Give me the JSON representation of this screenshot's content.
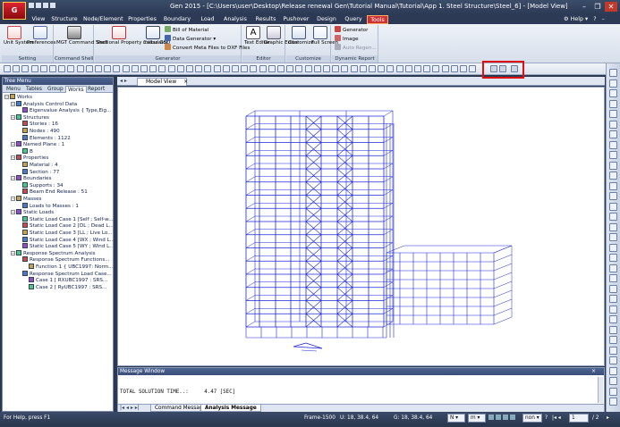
{
  "app": {
    "title": "Gen 2015 - [C:\\Users\\user\\Desktop\\Release renewal Gen\\Tutorial Manual\\Tutorial\\App 1. Steel Structure\\Steel_6] - [Model View]",
    "logo": "G"
  },
  "ribbon_tabs": [
    "View",
    "Structure",
    "Node/Element",
    "Properties",
    "Boundary",
    "Load",
    "Analysis",
    "Results",
    "Pushover",
    "Design",
    "Query",
    "Tools"
  ],
  "active_ribbon_tab": "Tools",
  "help": {
    "label": "Help"
  },
  "ribbon": {
    "groups": [
      {
        "label": "Setting",
        "buttons": [
          "Unit System",
          "Preferences"
        ]
      },
      {
        "label": "Command Shell",
        "buttons": [
          "MGT Command Shell"
        ]
      },
      {
        "label": "Generator",
        "buttons": [
          "Sectional Property Calculator",
          "midas GSD"
        ],
        "small": [
          "Bill of Material",
          "Data Generator",
          "Convert Meta Files to DXF Files"
        ]
      },
      {
        "label": "Editor",
        "buttons": [
          "Text Editor",
          "Graphic Editor"
        ]
      },
      {
        "label": "Customize",
        "buttons": [
          "Customize",
          "Full Screen"
        ]
      },
      {
        "label": "Dynamic Report",
        "small": [
          "Generator",
          "Image",
          "Auto Regen..."
        ]
      }
    ]
  },
  "tree_menu": {
    "title": "Tree Menu",
    "tabs": [
      "Menu",
      "Tables",
      "Group",
      "Works",
      "Report"
    ],
    "active_tab": "Works",
    "nodes": [
      {
        "label": "Works",
        "level": 0
      },
      {
        "label": "Analysis Control Data",
        "level": 1
      },
      {
        "label": "Eigenvalue Analysis { Type,Eig...",
        "level": 2
      },
      {
        "label": "Structures",
        "level": 1
      },
      {
        "label": "Stories : 16",
        "level": 2
      },
      {
        "label": "Nodes : 490",
        "level": 2
      },
      {
        "label": "Elements : 1122",
        "level": 2
      },
      {
        "label": "Named Plane : 1",
        "level": 1
      },
      {
        "label": "B",
        "level": 2
      },
      {
        "label": "Properties",
        "level": 1
      },
      {
        "label": "Material : 4",
        "level": 2
      },
      {
        "label": "Section : 77",
        "level": 2
      },
      {
        "label": "Boundaries",
        "level": 1
      },
      {
        "label": "Supports : 34",
        "level": 2
      },
      {
        "label": "Beam End Release : 51",
        "level": 2
      },
      {
        "label": "Masses",
        "level": 1
      },
      {
        "label": "Loads to Masses : 1",
        "level": 2
      },
      {
        "label": "Static Loads",
        "level": 1
      },
      {
        "label": "Static Load Case 1 [Self ; Self-w...",
        "level": 2
      },
      {
        "label": "Static Load Case 2 [DL ; Dead L...",
        "level": 2
      },
      {
        "label": "Static Load Case 3 [LL ; Live Lo...",
        "level": 2
      },
      {
        "label": "Static Load Case 4 [WX ; Wind L...",
        "level": 2
      },
      {
        "label": "Static Load Case 5 [WY ; Wind L...",
        "level": 2
      },
      {
        "label": "Response Spectrum Analysis",
        "level": 1
      },
      {
        "label": "Response Spectrum Functions...",
        "level": 2
      },
      {
        "label": "Function 1 { UBC1997: Norm...",
        "level": 3
      },
      {
        "label": "Response Spectrum Load Case...",
        "level": 2
      },
      {
        "label": "Case 1 [ RXUBC1997 : SRS...",
        "level": 3
      },
      {
        "label": "Case 2 [ RyUBC1997 : SRS...",
        "level": 3
      }
    ]
  },
  "document": {
    "tab_label": "Model View"
  },
  "message_window": {
    "title": "Message Window",
    "lines": [
      "TOTAL SOLUTION TIME..:     4.47 [SEC]",
      "--------------------------------------------------------------------------------"
    ],
    "tabs": [
      "Command Message",
      "Analysis Message"
    ],
    "active_tab": "Analysis Message"
  },
  "statusbar": {
    "help_text": "For Help, press F1",
    "frame": "Frame-1500",
    "u_coords": "U: 18, 38.4, 64",
    "g_coords": "G: 18, 38.4, 64",
    "unit_force": "N",
    "unit_length": "m",
    "view_mode": "non",
    "page_current": "1",
    "page_total": "2"
  },
  "colors": {
    "structure": "#1d28d8",
    "accent_tab": "#cc3333",
    "highlight": "#e01010"
  }
}
